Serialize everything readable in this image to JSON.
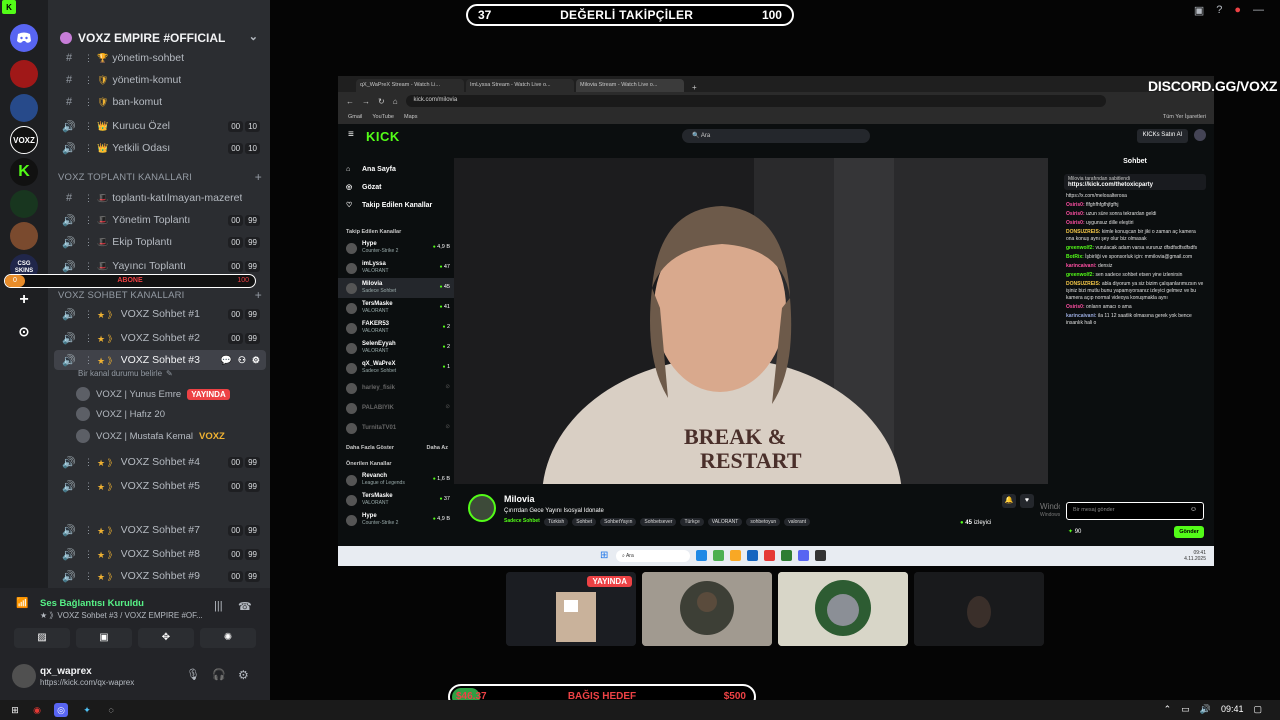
{
  "top_bar": {
    "left": "37",
    "title": "DEĞERLİ TAKİPÇİLER",
    "right": "100"
  },
  "discord": {
    "server_name": "VOXZ EMPIRE #OFFICIAL",
    "channels_top": [
      {
        "name": "yönetim-sohbet",
        "icon": "#",
        "emoji": "🏆"
      },
      {
        "name": "yönetim-komut",
        "icon": "#",
        "emoji": "🛡"
      },
      {
        "name": "ban-komut",
        "icon": "#",
        "emoji": "🛡"
      },
      {
        "name": "Kurucu Özel",
        "icon": "🔊",
        "emoji": "👑",
        "counts": [
          "00",
          "10"
        ]
      },
      {
        "name": "Yetkili Odası",
        "icon": "🔊",
        "emoji": "👑",
        "counts": [
          "00",
          "10"
        ]
      }
    ],
    "category_meetings": "VOXZ   TOPLANTI KANALLARI",
    "meeting_channels": [
      {
        "name": "toplantı-katılmayan-mazeret",
        "icon": "#",
        "emoji": "🎩"
      },
      {
        "name": "Yönetim Toplantı",
        "icon": "🔊",
        "emoji": "🎩",
        "counts": [
          "00",
          "99"
        ]
      },
      {
        "name": "Ekip Toplantı",
        "icon": "🔊",
        "emoji": "🎩",
        "counts": [
          "00",
          "99"
        ]
      },
      {
        "name": "Yayıncı Toplantı",
        "icon": "🔊",
        "emoji": "🎩",
        "counts": [
          "00",
          "99"
        ]
      }
    ],
    "abone": {
      "left": "0",
      "label": "ABONE",
      "right": "100"
    },
    "category_chat": "VOXZ   SOHBET KANALLARI",
    "chat_channels": [
      {
        "name": "VOXZ Sohbet #1",
        "counts": [
          "00",
          "99"
        ]
      },
      {
        "name": "VOXZ Sohbet #2",
        "counts": [
          "00",
          "99"
        ]
      },
      {
        "name": "VOXZ Sohbet #3",
        "active": true
      },
      {
        "name": "VOXZ Sohbet #4",
        "counts": [
          "00",
          "99"
        ]
      },
      {
        "name": "VOXZ Sohbet #5",
        "counts": [
          "00",
          "99"
        ]
      },
      {
        "name": "VOXZ Sohbet #7",
        "counts": [
          "00",
          "99"
        ]
      },
      {
        "name": "VOXZ Sohbet #8",
        "counts": [
          "00",
          "99"
        ]
      },
      {
        "name": "VOXZ Sohbet #9",
        "counts": [
          "00",
          "99"
        ]
      }
    ],
    "channel_status": "Bir kanal durumu belirle",
    "members": [
      {
        "name": "VOXZ | Yunus Emre",
        "badge": "YAYINDA"
      },
      {
        "name": "VOXZ | Hafız 20"
      },
      {
        "name": "VOXZ | Mustafa Kemal",
        "tag": "VOXZ"
      }
    ],
    "voice_status": "Ses Bağlantısı Kuruldu",
    "voice_channel": "★ 》VOXZ Sohbet #3 / VOXZ EMPIRE #OF...",
    "username": "qx_waprex",
    "user_status": "https://kick.com/qx-waprex",
    "rail_labels": {
      "csgo": "CSG SKINS",
      "voxz": "VOXZ"
    }
  },
  "browser": {
    "tabs": [
      "qX_WaPreX Stream - Watch Li...",
      "ImLyssa Stream - Watch Live o...",
      "Milovia Stream - Watch Live o..."
    ],
    "url": "kick.com/milovia",
    "bookmarks": [
      "Gmail",
      "YouTube",
      "Maps"
    ],
    "all_bookmarks": "Tüm Yer İşaretleri"
  },
  "kick": {
    "logo": "KICK",
    "search_placeholder": "Ara",
    "buy_label": "KICKs Satın Al",
    "nav": [
      "Ana Sayfa",
      "Gözat",
      "Takip Edilen Kanallar"
    ],
    "followed_label": "Takip Edilen Kanallar",
    "followed": [
      {
        "name": "Hype",
        "game": "Counter-Strike 2",
        "viewers": "4,9 B"
      },
      {
        "name": "imLyssa",
        "game": "VALORANT",
        "viewers": "47"
      },
      {
        "name": "Milovia",
        "game": "Sadece Sohbet",
        "viewers": "45",
        "selected": true
      },
      {
        "name": "TersMaske",
        "game": "VALORANT",
        "viewers": "41"
      },
      {
        "name": "FAKER53",
        "game": "VALORANT",
        "viewers": "2"
      },
      {
        "name": "SelenEyyah",
        "game": "VALORANT",
        "viewers": "2"
      },
      {
        "name": "qX_WaPreX",
        "game": "Sadece Sohbet",
        "viewers": "1"
      },
      {
        "name": "harley_fisik",
        "off": true
      },
      {
        "name": "PALABIYIK",
        "off": true
      },
      {
        "name": "TurnitaTV01",
        "off": true
      }
    ],
    "show_more": "Daha Fazla Göster",
    "show_less": "Daha Az",
    "suggested_label": "Önerilen Kanallar",
    "suggested": [
      {
        "name": "Revanch",
        "game": "League of Legends",
        "viewers": "1,6 B"
      },
      {
        "name": "TersMaske",
        "game": "VALORANT",
        "viewers": "37"
      },
      {
        "name": "Hype",
        "game": "Counter-Strike 2",
        "viewers": "4,9 B"
      }
    ],
    "stream": {
      "streamer": "Milovia",
      "title": "Çırırrdan Gece Yayını Isosyal Idonate",
      "category": "Sadece Sohbet",
      "tags": [
        "Türkish",
        "Sohbet",
        "SohbetYayın",
        "Sohbetsever",
        "Türkçe",
        "VALORANT",
        "sohbetoyun",
        "valorant"
      ],
      "viewers": "45",
      "viewers_label": "izleyici"
    },
    "chat": {
      "title": "Sohbet",
      "pinned_by": "Milovia tarafından sabitlendi",
      "pinned_link": "https://kick.com/thetoxicparty",
      "messages": [
        {
          "user": "",
          "text": "https://x.com/melosalterosa"
        },
        {
          "user": "Osiris0:",
          "text": "flfghfhfgfhjfgfhj"
        },
        {
          "user": "Osiris0:",
          "text": "uzun süre sonra tekrardan geldi"
        },
        {
          "user": "Osiris0:",
          "text": "uygunsuz dille eleştiri"
        },
        {
          "user": "DONSUZREIS:",
          "text": "kimle konuşcan bir jiki o zaman aç kamera ona konuş aynı şey olur biz olmasak"
        },
        {
          "user": "greenwolf2:",
          "text": "vurulacak adam varsa vururuz dfsdfsdfsdfsdfs"
        },
        {
          "user": "BotRix:",
          "text": "İşbirliği ve sponsorluk için: mmilovia@gmail.com"
        },
        {
          "user": "karincaivani:",
          "text": "densiz"
        },
        {
          "user": "greenwolf2:",
          "text": "sen sadece sohbet etsen yine izlenirsin"
        },
        {
          "user": "DONSUZREIS:",
          "text": "abla diyorum ya siz bizim çalışanlarımızsın ve işiniz bizi mutlu bunu yapamıyorsanız izleyici gelmez ve bu kamera açıp normal videoya konuşmakla aynı"
        },
        {
          "user": "Osiris0:",
          "text": "onların amacı o ama"
        },
        {
          "user": "karincaivani:",
          "text": "ila 11 12 saatlik olmasına gerek yok bence insanlık hali o"
        }
      ],
      "input_placeholder": "Bir mesaj gönder",
      "points": "90",
      "send_label": "Gönder"
    },
    "windows_activate": "Windows'u Etkinleştir",
    "windows_activate_sub": "Windows'u etkinleştirmek için Ayarlar'a gidin."
  },
  "discord_url": "DISCORD.GG/VOXZ",
  "cams": {
    "live_label": "YAYINDA"
  },
  "donation": {
    "left": "$46.37",
    "label": "BAĞIŞ HEDEF",
    "right": "$500",
    "fraction": 0.093
  },
  "taskbar": {
    "search": "Ara",
    "time": "09:41",
    "tray_clock": "09:41",
    "tray_date": "4.11.2025"
  },
  "colors": {
    "kick_green": "#53fc18",
    "discord_bg": "#2b2d31",
    "live_red": "#ed4245"
  }
}
